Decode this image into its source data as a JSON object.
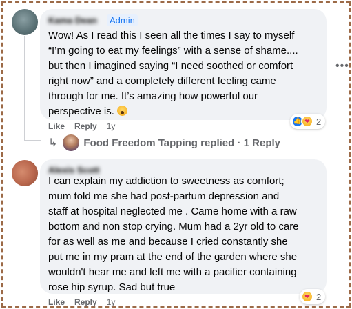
{
  "comments": [
    {
      "author": "Kama Dean",
      "badge": "Admin",
      "lines": [
        "Wow! As I read this I seen all the times I say to myself",
        "“I’m going to eat my feelings” with a sense of shame....",
        "but then I imagined saying “I need soothed or comfort",
        "right now” and a completely different feeling came",
        "through for me. It’s amazing how powerful our",
        "perspective is."
      ],
      "like_label": "Like",
      "reply_label": "Reply",
      "time": "1y",
      "reaction_count": "2",
      "reactions": [
        "like-icon",
        "care-icon"
      ]
    },
    {
      "author": "Alexis Scott",
      "lines": [
        "I can explain my addiction to sweetness as comfort;",
        "mum told me she had post-partum depression and",
        "staff at hospital neglected me . Came home with a raw",
        "bottom and non stop crying. Mum had a 2yr old to care",
        "for as well as me and because I cried constantly she",
        "put me in my pram at the end of the garden where she",
        "wouldn't hear me and left me with a pacifier containing",
        "rose hip syrup. Sad but true"
      ],
      "like_label": "Like",
      "reply_label": "Reply",
      "time": "1y",
      "reaction_count": "2",
      "reactions": [
        "care-icon"
      ]
    }
  ],
  "reply_thread": {
    "text": "Food Freedom Tapping replied · 1 Reply"
  },
  "more_icon": "more-options-icon",
  "colors": {
    "bubble": "#f0f2f5",
    "secondary_text": "#65676b",
    "admin_badge_bg": "#e7f0fd",
    "admin_badge_text": "#1877f2",
    "frame_border": "#9c6a47"
  }
}
